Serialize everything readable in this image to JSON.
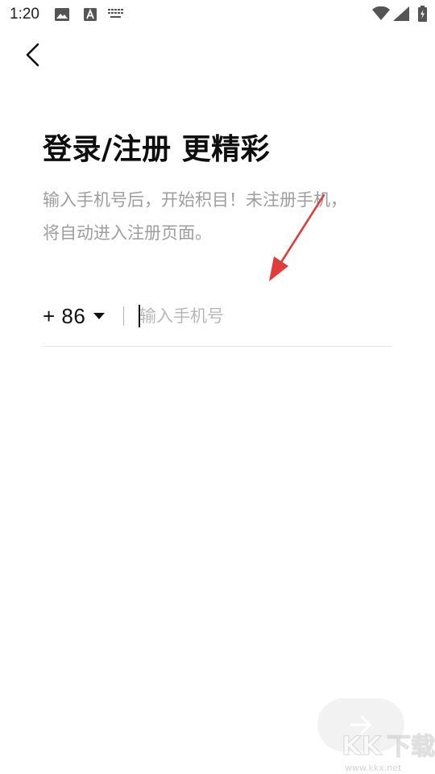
{
  "status_bar": {
    "time": "1:20",
    "icons": [
      "image-icon",
      "a-icon",
      "keyboard-icon",
      "wifi-icon",
      "signal-icon",
      "battery-icon"
    ]
  },
  "header": {
    "back_icon": "chevron-left-icon"
  },
  "main": {
    "title": "登录/注册 更精彩",
    "subtitle_line1": "输入手机号后，开始积目！未注册手机，",
    "subtitle_line2": "将自动进入注册页面。",
    "country_code": "+ 86",
    "divider": "|",
    "phone_placeholder": "输入手机号",
    "phone_value": ""
  },
  "footer": {
    "next_icon": "arrow-right-icon"
  },
  "annotation": {
    "color": "#e03c3c"
  },
  "watermark": {
    "brand": "KK下载",
    "url": "www.kkx.net"
  },
  "colors": {
    "title": "#0d0d0d",
    "subtitle": "#9e9e9e",
    "placeholder": "#b8b8b8",
    "button_bg": "#f2f2f2"
  }
}
